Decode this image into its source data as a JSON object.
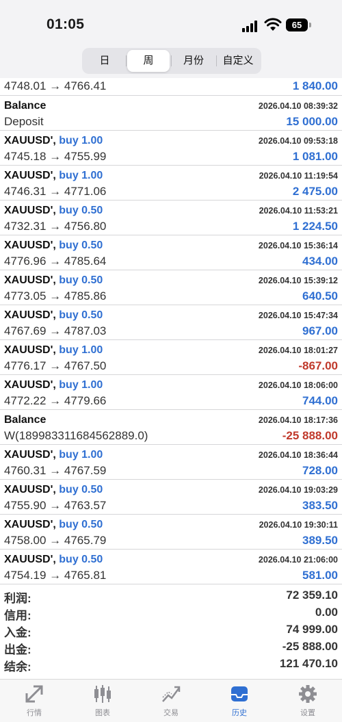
{
  "status": {
    "time": "01:05",
    "battery": "65"
  },
  "periods": {
    "tabs": [
      "日",
      "周",
      "月份",
      "自定义"
    ],
    "active": "周"
  },
  "deals": [
    {
      "symbol": "",
      "side": "",
      "time": "",
      "price": "4748.01 → 4766.41",
      "profit": "1 840.00",
      "negative": false
    },
    {
      "symbol": "Balance",
      "side": "",
      "time": "2026.04.10 08:39:32",
      "price": "Deposit",
      "profit": "15 000.00",
      "negative": false
    },
    {
      "symbol": "XAUUSD',",
      "side": "buy 1.00",
      "time": "2026.04.10 09:53:18",
      "price": "4745.18 → 4755.99",
      "profit": "1 081.00",
      "negative": false
    },
    {
      "symbol": "XAUUSD',",
      "side": "buy 1.00",
      "time": "2026.04.10 11:19:54",
      "price": "4746.31 → 4771.06",
      "profit": "2 475.00",
      "negative": false
    },
    {
      "symbol": "XAUUSD',",
      "side": "buy 0.50",
      "time": "2026.04.10 11:53:21",
      "price": "4732.31 → 4756.80",
      "profit": "1 224.50",
      "negative": false
    },
    {
      "symbol": "XAUUSD',",
      "side": "buy 0.50",
      "time": "2026.04.10 15:36:14",
      "price": "4776.96 → 4785.64",
      "profit": "434.00",
      "negative": false
    },
    {
      "symbol": "XAUUSD',",
      "side": "buy 0.50",
      "time": "2026.04.10 15:39:12",
      "price": "4773.05 → 4785.86",
      "profit": "640.50",
      "negative": false
    },
    {
      "symbol": "XAUUSD',",
      "side": "buy 0.50",
      "time": "2026.04.10 15:47:34",
      "price": "4767.69 → 4787.03",
      "profit": "967.00",
      "negative": false
    },
    {
      "symbol": "XAUUSD',",
      "side": "buy 1.00",
      "time": "2026.04.10 18:01:27",
      "price": "4776.17 → 4767.50",
      "profit": "-867.00",
      "negative": true
    },
    {
      "symbol": "XAUUSD',",
      "side": "buy 1.00",
      "time": "2026.04.10 18:06:00",
      "price": "4772.22 → 4779.66",
      "profit": "744.00",
      "negative": false
    },
    {
      "symbol": "Balance",
      "side": "",
      "time": "2026.04.10 18:17:36",
      "price": "W(189983311684562889.0)",
      "profit": "-25 888.00",
      "negative": true
    },
    {
      "symbol": "XAUUSD',",
      "side": "buy 1.00",
      "time": "2026.04.10 18:36:44",
      "price": "4760.31 → 4767.59",
      "profit": "728.00",
      "negative": false
    },
    {
      "symbol": "XAUUSD',",
      "side": "buy 0.50",
      "time": "2026.04.10 19:03:29",
      "price": "4755.90 → 4763.57",
      "profit": "383.50",
      "negative": false
    },
    {
      "symbol": "XAUUSD',",
      "side": "buy 0.50",
      "time": "2026.04.10 19:30:11",
      "price": "4758.00 → 4765.79",
      "profit": "389.50",
      "negative": false
    },
    {
      "symbol": "XAUUSD',",
      "side": "buy 0.50",
      "time": "2026.04.10 21:06:00",
      "price": "4754.19 → 4765.81",
      "profit": "581.00",
      "negative": false
    }
  ],
  "summary": [
    {
      "label": "利润:",
      "value": "72 359.10"
    },
    {
      "label": "信用:",
      "value": "0.00"
    },
    {
      "label": "入金:",
      "value": "74 999.00"
    },
    {
      "label": "出金:",
      "value": "-25 888.00"
    },
    {
      "label": "结余:",
      "value": "121 470.10"
    }
  ],
  "tabbar": [
    {
      "label": "行情",
      "icon": "quotes-icon"
    },
    {
      "label": "图表",
      "icon": "chart-candles-icon"
    },
    {
      "label": "交易",
      "icon": "trade-icon"
    },
    {
      "label": "历史",
      "icon": "history-inbox-icon"
    },
    {
      "label": "设置",
      "icon": "gear-icon"
    }
  ],
  "colors": {
    "accent": "#2f6fd2",
    "negative": "#c0392b",
    "text": "#333333"
  }
}
